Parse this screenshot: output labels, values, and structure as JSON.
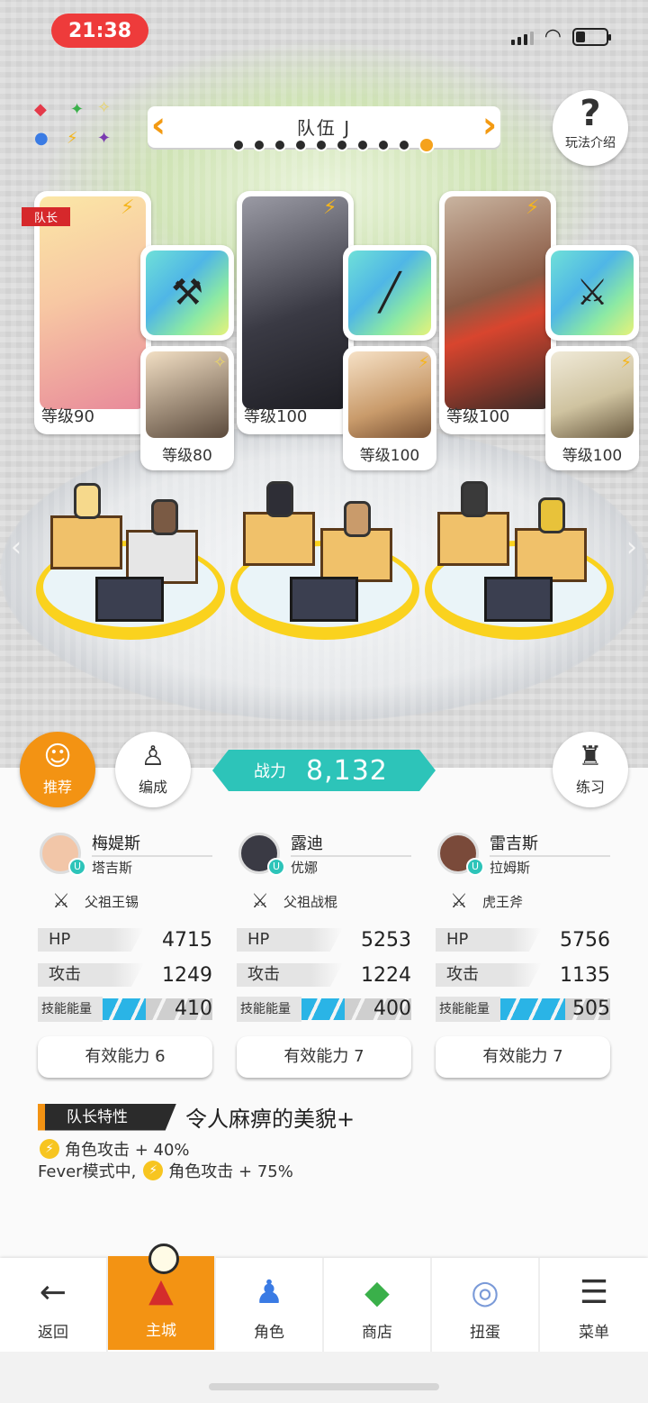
{
  "status_bar": {
    "time": "21:38"
  },
  "element_wheel": {
    "symbols": [
      "◆",
      "✦",
      "✧",
      "●",
      "⚡",
      "✦"
    ]
  },
  "team": {
    "name": "队伍 J",
    "page_count": 10,
    "active_index": 9
  },
  "help_button": {
    "label": "玩法介绍"
  },
  "cards": [
    {
      "leader_tag": "队长",
      "main_level": "等级90",
      "sub_level": "等级80",
      "main_color": "#f7c7a3",
      "sub_color": "#5b4a3c",
      "sub_icon": "✧"
    },
    {
      "leader_tag": "",
      "main_level": "等级100",
      "sub_level": "等级100",
      "main_color": "#4a4a55",
      "sub_color": "#c99b6b",
      "sub_icon": "⚡"
    },
    {
      "leader_tag": "",
      "main_level": "等级100",
      "sub_level": "等级100",
      "main_color": "#8a5a44",
      "sub_color": "#cfc3a0",
      "sub_icon": "⚡"
    }
  ],
  "buttons": {
    "recommend": "推荐",
    "formation": "编成",
    "practice": "练习"
  },
  "combat_power": {
    "label": "战力",
    "value": "8,132"
  },
  "characters": [
    {
      "name": "梅媞斯",
      "sub_name": "塔吉斯",
      "weapon": "父祖王锡",
      "avatar_color": "#f2c6a8",
      "hp_label": "HP",
      "hp": "4715",
      "atk_label": "攻击",
      "atk": "1249",
      "energy_label": "技能能量",
      "energy": "410",
      "energy_fill": 0.4,
      "effective": "有效能力 6"
    },
    {
      "name": "露迪",
      "sub_name": "优娜",
      "weapon": "父祖战棍",
      "avatar_color": "#3a3a44",
      "hp_label": "HP",
      "hp": "5253",
      "atk_label": "攻击",
      "atk": "1224",
      "energy_label": "技能能量",
      "energy": "400",
      "energy_fill": 0.4,
      "effective": "有效能力 7"
    },
    {
      "name": "雷吉斯",
      "sub_name": "拉姆斯",
      "weapon": "虎王斧",
      "avatar_color": "#7a4a3a",
      "hp_label": "HP",
      "hp": "5756",
      "atk_label": "攻击",
      "atk": "1135",
      "energy_label": "技能能量",
      "energy": "505",
      "energy_fill": 0.6,
      "effective": "有效能力 7"
    }
  ],
  "leader_skill": {
    "label": "队长特性",
    "title": "令人麻痹的美貌+",
    "line1": "角色攻击 + 40%",
    "line2_prefix": "Fever模式中,",
    "line2": "角色攻击 + 75%"
  },
  "tabs": [
    {
      "label": "返回",
      "icon": "←"
    },
    {
      "label": "主城",
      "icon": "▲"
    },
    {
      "label": "角色",
      "icon": "♟"
    },
    {
      "label": "商店",
      "icon": "◆"
    },
    {
      "label": "扭蛋",
      "icon": "◎"
    },
    {
      "label": "菜单",
      "icon": "☰"
    }
  ]
}
